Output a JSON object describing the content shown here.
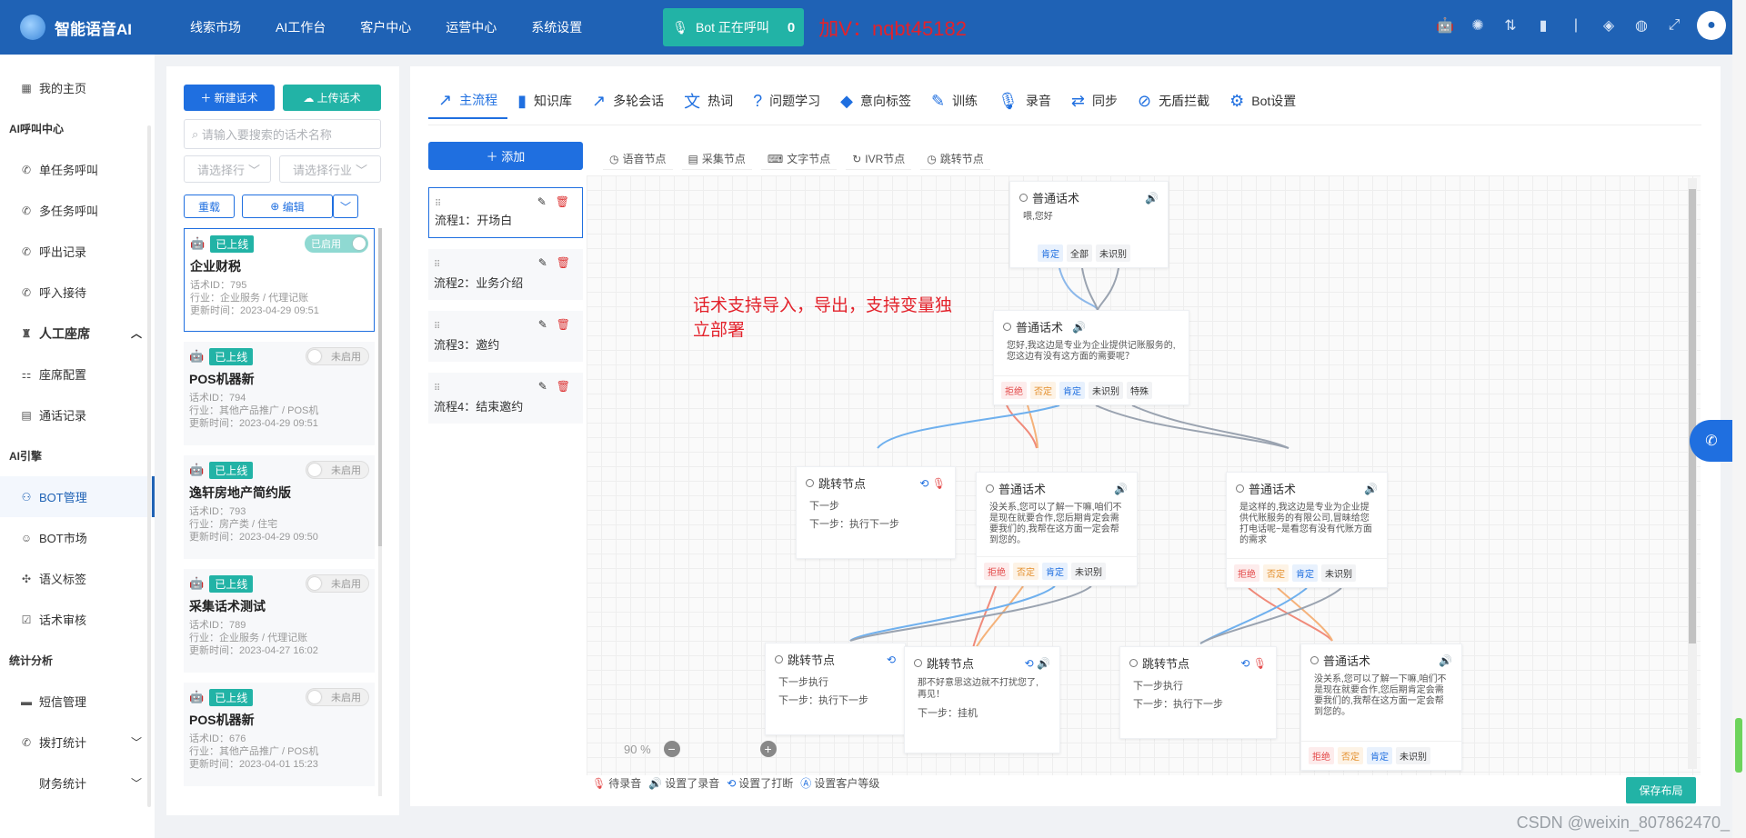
{
  "app": {
    "name": "智能语音AI"
  },
  "nav": [
    "线索市场",
    "AI工作台",
    "客户中心",
    "运营中心",
    "系统设置"
  ],
  "call": {
    "label": "Bot 正在呼叫",
    "count": "0"
  },
  "watermark": "加V：nqbt45182",
  "sidebar": {
    "home": "我的主页",
    "sec1": "AI呼叫中心",
    "items1": [
      "单任务呼叫",
      "多任务呼叫",
      "呼出记录",
      "呼入接待"
    ],
    "seat": "人工座席",
    "seat_items": [
      "座席配置",
      "通话记录"
    ],
    "sec2": "AI引擎",
    "items2": [
      "BOT管理",
      "BOT市场",
      "语义标签",
      "话术审核"
    ],
    "sec3": "统计分析",
    "items3": [
      "短信管理",
      "拨打统计",
      "财务统计"
    ]
  },
  "list": {
    "new_btn": "新建话术",
    "upload_btn": "上传话术",
    "search_placeholder": "请输入要搜索的话术名称",
    "sort1": "请选择行",
    "sort2": "请选择行业",
    "reset": "重载",
    "edit": "编辑",
    "cards": [
      {
        "badge": "已上线",
        "toggle": "已启用",
        "name": "企业财税",
        "id": "话术ID：795",
        "industry": "行业：企业服务 / 代理记账",
        "time": "更新时间：2023-04-29 09:51"
      },
      {
        "badge": "已上线",
        "toggle": "未启用",
        "name": "POS机器新",
        "id": "话术ID：794",
        "industry": "行业：其他产品推广 / POS机",
        "time": "更新时间：2023-04-29 09:51"
      },
      {
        "badge": "已上线",
        "toggle": "未启用",
        "name": "逸轩房地产简约版",
        "id": "话术ID：793",
        "industry": "行业：房产类 / 住宅",
        "time": "更新时间：2023-04-29 09:50"
      },
      {
        "badge": "已上线",
        "toggle": "未启用",
        "name": "采集话术测试",
        "id": "话术ID：789",
        "industry": "行业：企业服务 / 代理记账",
        "time": "更新时间：2023-04-27 16:02"
      },
      {
        "badge": "已上线",
        "toggle": "未启用",
        "name": "POS机器新",
        "id": "话术ID：676",
        "industry": "行业：其他产品推广 / POS机",
        "time": "更新时间：2023-04-01 15:23"
      }
    ]
  },
  "tabs": [
    "主流程",
    "知识库",
    "多轮会话",
    "热词",
    "问题学习",
    "意向标签",
    "训练",
    "录音",
    "同步",
    "无盾拦截",
    "Bot设置"
  ],
  "add_btn": "添加",
  "flows": [
    "流程1：开场白",
    "流程2：业务介绍",
    "流程3：邀约",
    "流程4：结束邀约"
  ],
  "node_tools": [
    "语音节点",
    "采集节点",
    "文字节点",
    "IVR节点",
    "跳转节点"
  ],
  "overlay": "话术支持导入，导出，支持变量独立部署",
  "nodes": {
    "n1": {
      "title": "普通话术",
      "body": "喂,您好",
      "tags": [
        "肯定",
        "全部",
        "未识别"
      ]
    },
    "n2": {
      "title": "普通话术",
      "body": "您好,我这边是专业为企业提供记账服务的,您这边有没有这方面的需要呢？",
      "tags": [
        "拒绝",
        "否定",
        "肯定",
        "未识别",
        "特殊"
      ]
    },
    "j1": {
      "title": "跳转节点",
      "l1": "下一步",
      "l2": "下一步：执行下一步"
    },
    "n3": {
      "title": "普通话术",
      "body": "没关系,您可以了解一下嘛,咱们不是现在就要合作,您后期肯定会需要我们的,我帮在这方面一定会帮到您的。",
      "tags": [
        "拒绝",
        "否定",
        "肯定",
        "未识别"
      ]
    },
    "n4": {
      "title": "普通话术",
      "body": "是这样的,我这边是专业为企业提供代账服务的有限公司,冒昧给您打电话呢~是看您有没有代账方面的需求",
      "tags": [
        "拒绝",
        "否定",
        "肯定",
        "未识别"
      ]
    },
    "j2": {
      "title": "跳转节点",
      "l1": "下一步执行",
      "l2": "下一步：执行下一步"
    },
    "j3": {
      "title": "跳转节点",
      "l1": "那不好意思这边就不打扰您了,再见！",
      "l2": "下一步：挂机"
    },
    "j4": {
      "title": "跳转节点",
      "l1": "下一步执行",
      "l2": "下一步：执行下一步"
    },
    "n5": {
      "title": "普通话术",
      "body": "没关系,您可以了解一下嘛,咱们不是现在就要合作,您后期肯定会需要我们的,我帮在这方面一定会帮到您的。",
      "tags": [
        "拒绝",
        "否定",
        "肯定",
        "未识别"
      ]
    }
  },
  "zoom": "90 %",
  "legend": [
    "待录音",
    "设置了录音",
    "设置了打断",
    "设置客户等级"
  ],
  "save": "保存布局",
  "csdn": "CSDN @weixin_807862470_"
}
